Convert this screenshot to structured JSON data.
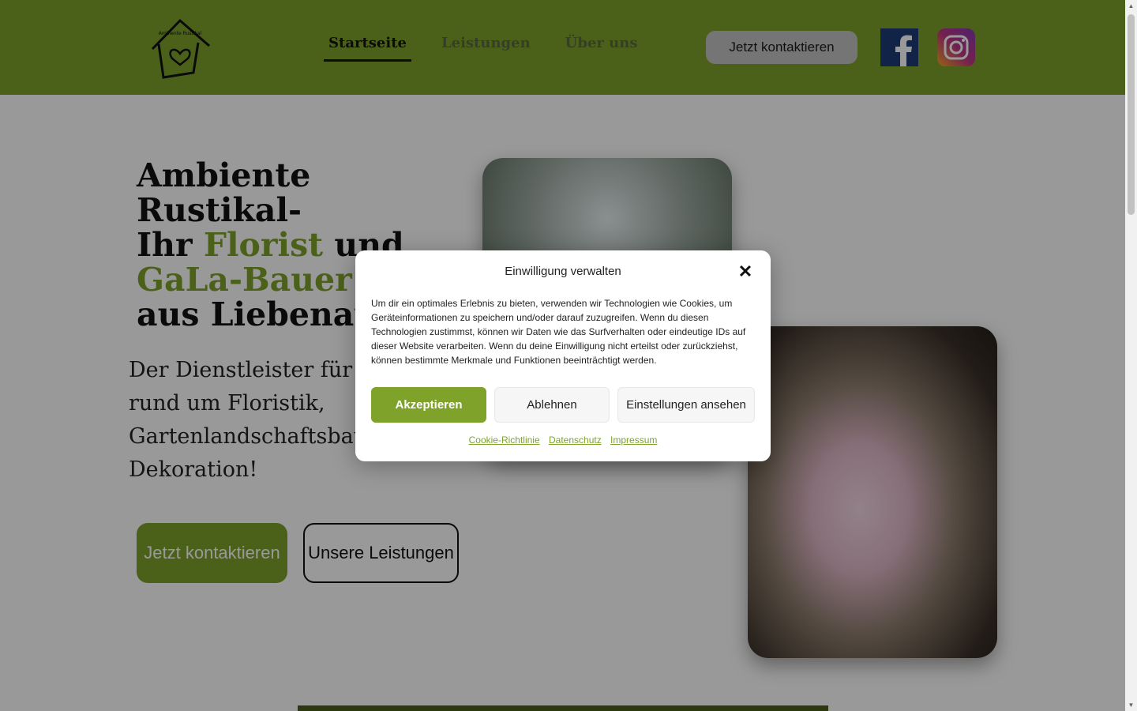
{
  "header": {
    "logo_label": "Ambiente Rustikal",
    "nav": [
      {
        "label": "Startseite",
        "active": true
      },
      {
        "label": "Leistungen",
        "active": false
      },
      {
        "label": "Über uns",
        "active": false
      }
    ],
    "cta_label": "Jetzt kontaktieren",
    "social": [
      {
        "icon": "facebook-icon",
        "color": "#1d3b75"
      },
      {
        "icon": "instagram-icon",
        "color": "#c13584"
      }
    ]
  },
  "hero": {
    "title_lines": [
      "Ambiente",
      "Rustikal-"
    ],
    "title_line3_prefix": "Ihr",
    "title_line3_accent": "Florist",
    "title_line3_suffix": "und",
    "title_line4_accent": "GaLa-Bauer",
    "title_line5": "aus Liebenau",
    "subtitle": "Der Dienstleister für alles rund um Floristik, Gartenlandschaftsbau und Dekoration!",
    "primary_button": "Jetzt kontaktieren",
    "secondary_button": "Unsere Leistungen"
  },
  "modal": {
    "title": "Einwilligung verwalten",
    "text": "Um dir ein optimales Erlebnis zu bieten, verwenden wir Technologien wie Cookies, um Geräteinformationen zu speichern und/oder darauf zuzugreifen. Wenn du diesen Technologien zustimmst, können wir Daten wie das Surfverhalten oder eindeutige IDs auf dieser Website verarbeiten. Wenn du deine Einwilligung nicht erteilst oder zurückziehst, können bestimmte Merkmale und Funktionen beeinträchtigt werden.",
    "accept_label": "Akzeptieren",
    "deny_label": "Ablehnen",
    "settings_label": "Einstellungen ansehen",
    "links": [
      "Cookie-Richtlinie",
      "Datenschutz",
      "Impressum"
    ]
  },
  "colors": {
    "brand_green": "#7ea22a",
    "text_dark": "#111111"
  }
}
